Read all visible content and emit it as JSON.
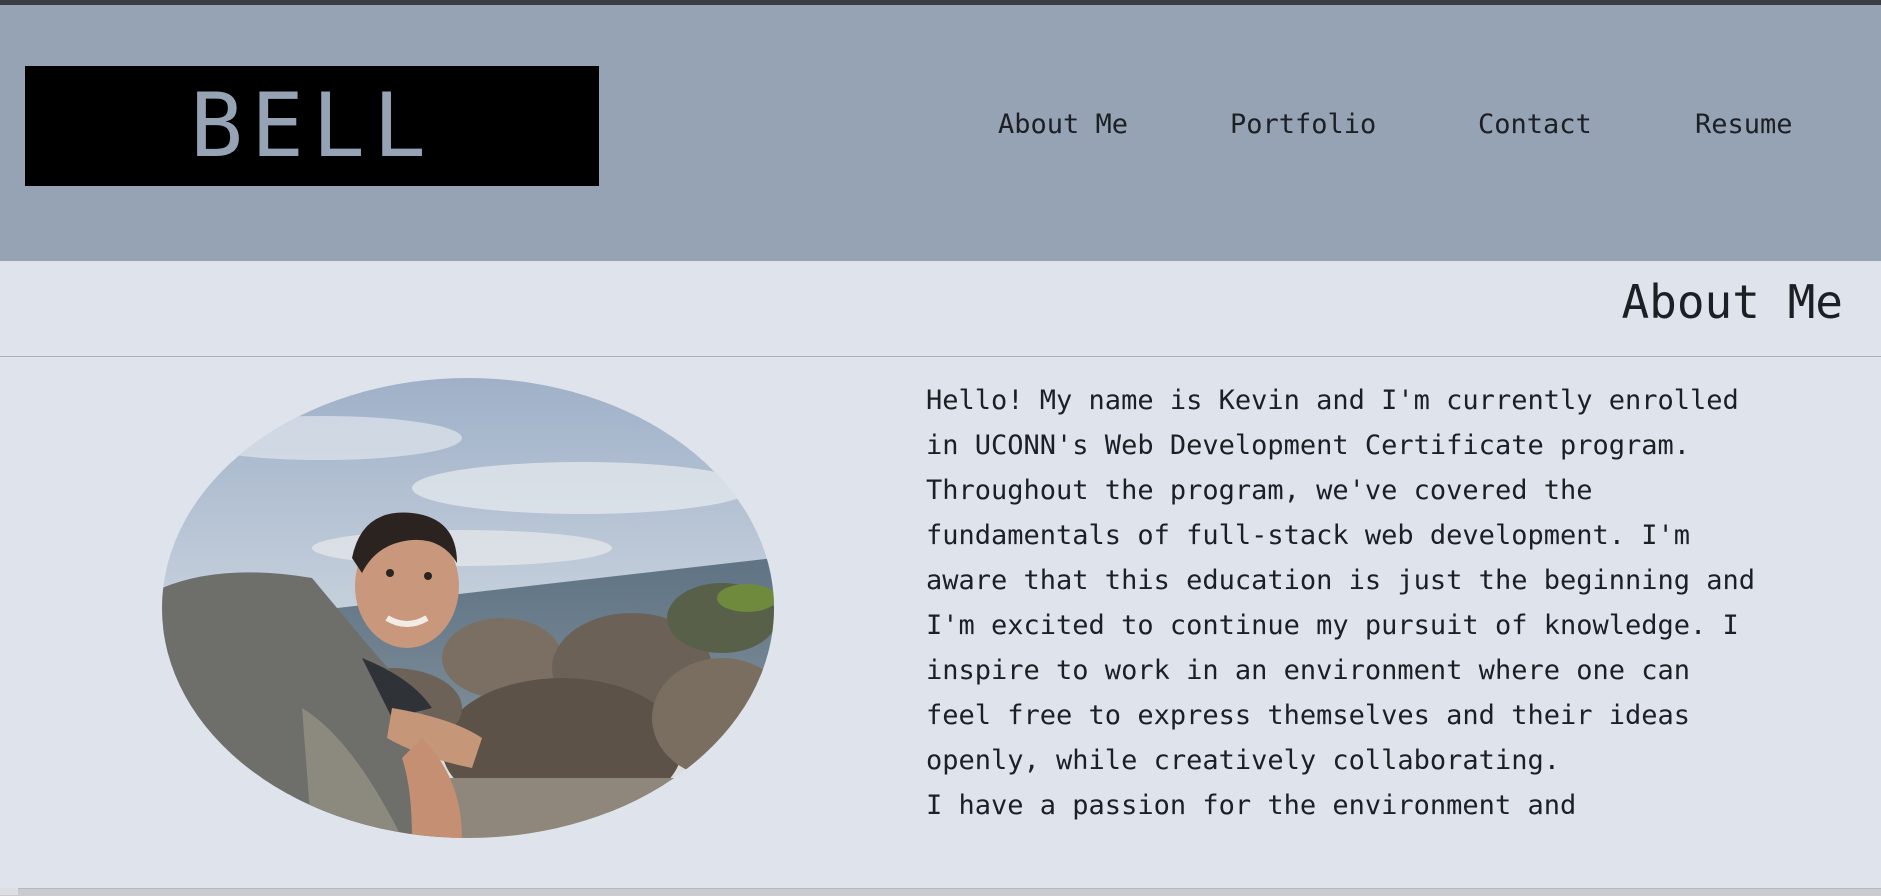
{
  "header": {
    "logo_text": "BELL",
    "nav": [
      {
        "label": "About Me"
      },
      {
        "label": "Portfolio"
      },
      {
        "label": "Contact"
      },
      {
        "label": "Resume"
      }
    ]
  },
  "section": {
    "title": "About Me"
  },
  "bio": {
    "paragraph_1": "Hello! My name is Kevin and I'm currently enrolled in UCONN's Web Development Certificate program. Throughout the program, we've covered the fundamentals of full-stack web development. I'm aware that this education is just the beginning and I'm excited to continue my pursuit of knowledge. I inspire to work in an environment where one can feel free to express themselves and their ideas openly, while creatively collaborating.",
    "paragraph_2": "I have a passion for the environment and"
  },
  "colors": {
    "header_bg": "#95a3b5",
    "page_bg": "#dee3ec",
    "logo_bg": "#000000",
    "text": "#1c1f24"
  },
  "icons": {
    "profile_photo": "profile-photo"
  }
}
